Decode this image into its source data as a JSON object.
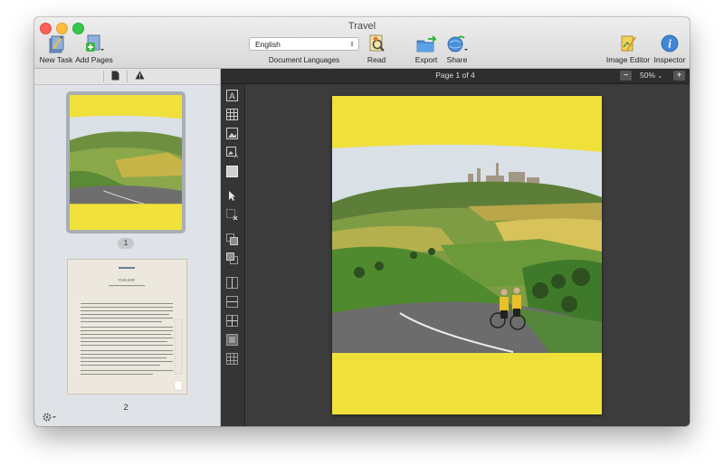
{
  "window": {
    "title": "Travel"
  },
  "toolbar": {
    "new_task": "New Task",
    "add_pages": "Add Pages",
    "language_value": "English",
    "language_label": "Document Languages",
    "read": "Read",
    "export": "Export",
    "share": "Share",
    "image_editor": "Image Editor",
    "inspector": "Inspector"
  },
  "sidebar": {
    "pages": [
      {
        "number": "1",
        "description": "cyclists on a road in Tuscany, yellow border"
      },
      {
        "number": "2",
        "description": "text page"
      }
    ],
    "page2_heading": "TUSCANY"
  },
  "viewer": {
    "page_info": "Page 1 of 4",
    "zoom": "50%",
    "zoom_out": "−",
    "zoom_in": "+",
    "zoom_arrow": "⌄"
  },
  "colors": {
    "page_yellow": "#f0e03a",
    "sky": "#d9e0e6",
    "hills": "#5d8a3a",
    "road": "#6e6e6e"
  },
  "icons": [
    "new-task-icon",
    "add-pages-icon",
    "read-icon",
    "export-icon",
    "share-icon",
    "image-editor-icon",
    "inspector-icon",
    "gear-icon",
    "page-icon",
    "warning-icon"
  ]
}
